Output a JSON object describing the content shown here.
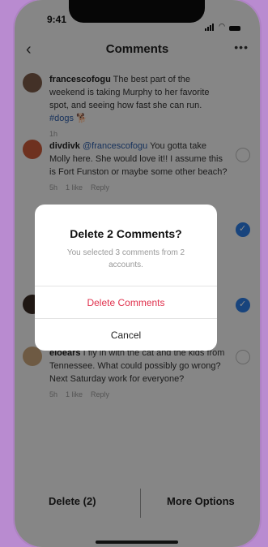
{
  "status": {
    "time": "9:41"
  },
  "header": {
    "title": "Comments",
    "back_icon": "chevron-left-icon",
    "more_icon": "more-horizontal-icon"
  },
  "comments": [
    {
      "user": "francescofogu",
      "text": "The best part of the weekend is taking Murphy to her favorite spot, and seeing how fast she can run.",
      "tag": "#dogs",
      "emoji": "🐕",
      "time": "1h",
      "selected": false
    },
    {
      "user": "divdivk",
      "mention": "@francescofogu",
      "text": "You gotta take Molly here. She would love it!! I assume this is Fort Funston or maybe some other beach?",
      "time": "5h",
      "likes": "1 like",
      "reply": "Reply",
      "selected": false
    },
    {
      "user": "eloears",
      "text": "I fly in with the cat and the kids from Tennessee. What could possibly go wrong? Next Saturday work for everyone?",
      "time": "5h",
      "likes": "1 like",
      "reply": "Reply",
      "selected": false
    }
  ],
  "selection_marks": [
    {
      "state": "selected"
    },
    {
      "state": "selected"
    }
  ],
  "bottom_bar": {
    "delete_label": "Delete (2)",
    "more_label": "More Options"
  },
  "dialog": {
    "title": "Delete 2 Comments?",
    "message": "You selected 3 comments from 2 accounts.",
    "delete_label": "Delete Comments",
    "cancel_label": "Cancel"
  },
  "colors": {
    "accent": "#2c7de3",
    "destructive": "#e0314d",
    "backdrop": "#b98bd0"
  }
}
